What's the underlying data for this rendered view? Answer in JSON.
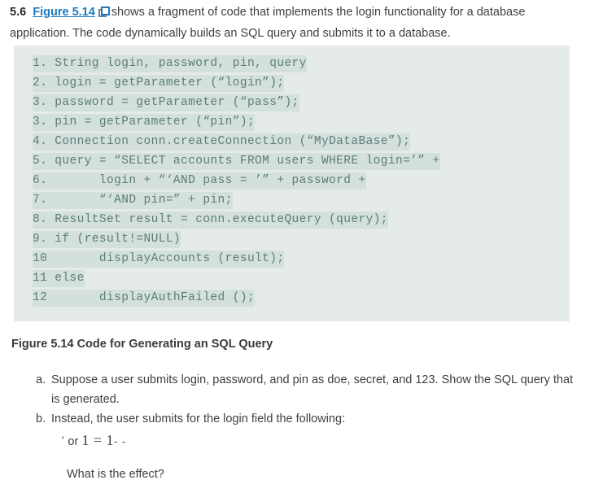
{
  "intro": {
    "question_number": "5.6",
    "figure_link": "Figure 5.14",
    "popup_icon": "popup-window-icon",
    "text_after_link": "shows a fragment of code that implements the login functionality for a database application. The code dynamically builds an SQL query and submits it to a database."
  },
  "code": {
    "lines": [
      "1. String login, password, pin, query",
      "2. login = getParameter (“login”);",
      "3. password = getParameter (“pass”);",
      "3. pin = getParameter (“pin”);",
      "4. Connection conn.createConnection (“MyDataBase”);",
      "5. query = “SELECT accounts FROM users WHERE login=’” +",
      "6.       login + “‘AND pass = ’” + password +",
      "7.       “‘AND pin=” + pin;",
      "8. ResultSet result = conn.executeQuery (query);",
      "9. if (result!=NULL)",
      "10       displayAccounts (result);",
      "11 else",
      "12       displayAuthFailed ();"
    ]
  },
  "figure_caption": "Figure 5.14 Code for Generating an SQL Query",
  "questions": [
    {
      "marker": "a.",
      "text": "Suppose a user submits login, password, and pin as doe, secret, and 123. Show the SQL query that is generated."
    },
    {
      "marker": "b.",
      "text": "Instead, the user submits for the login field the following:"
    }
  ],
  "injection": {
    "quote": "’",
    "or": "or",
    "expr": "1 = 1",
    "comment": "- -"
  },
  "effect_question": "What is the effect?",
  "colors": {
    "link_blue": "#1a7bc0",
    "code_bg": "#e4ebe9",
    "code_highlight": "#d4e0dc",
    "code_text": "#5c7d79",
    "body_text": "#3f3f3f"
  }
}
